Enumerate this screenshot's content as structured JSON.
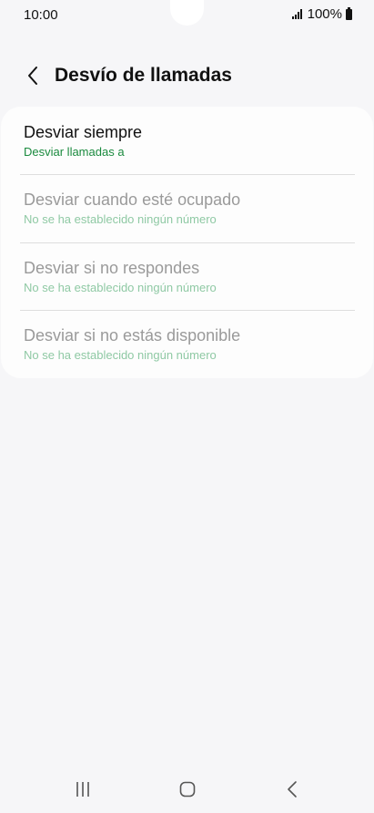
{
  "status_bar": {
    "time": "10:00",
    "battery": "100%"
  },
  "header": {
    "title": "Desvío de llamadas"
  },
  "items": [
    {
      "title": "Desviar siempre",
      "subtitle": "Desviar llamadas a",
      "enabled": true
    },
    {
      "title": "Desviar cuando esté ocupado",
      "subtitle": "No se ha establecido ningún número",
      "enabled": false
    },
    {
      "title": "Desviar si no respondes",
      "subtitle": "No se ha establecido ningún número",
      "enabled": false
    },
    {
      "title": "Desviar si no estás disponible",
      "subtitle": "No se ha establecido ningún número",
      "enabled": false
    }
  ],
  "colors": {
    "background": "#f6f6f8",
    "accent_green": "#1a8a3e",
    "disabled_text": "#9a9a9a"
  },
  "nav": {
    "recents_icon": "recents-icon",
    "home_icon": "home-icon",
    "back_icon": "back-icon"
  }
}
